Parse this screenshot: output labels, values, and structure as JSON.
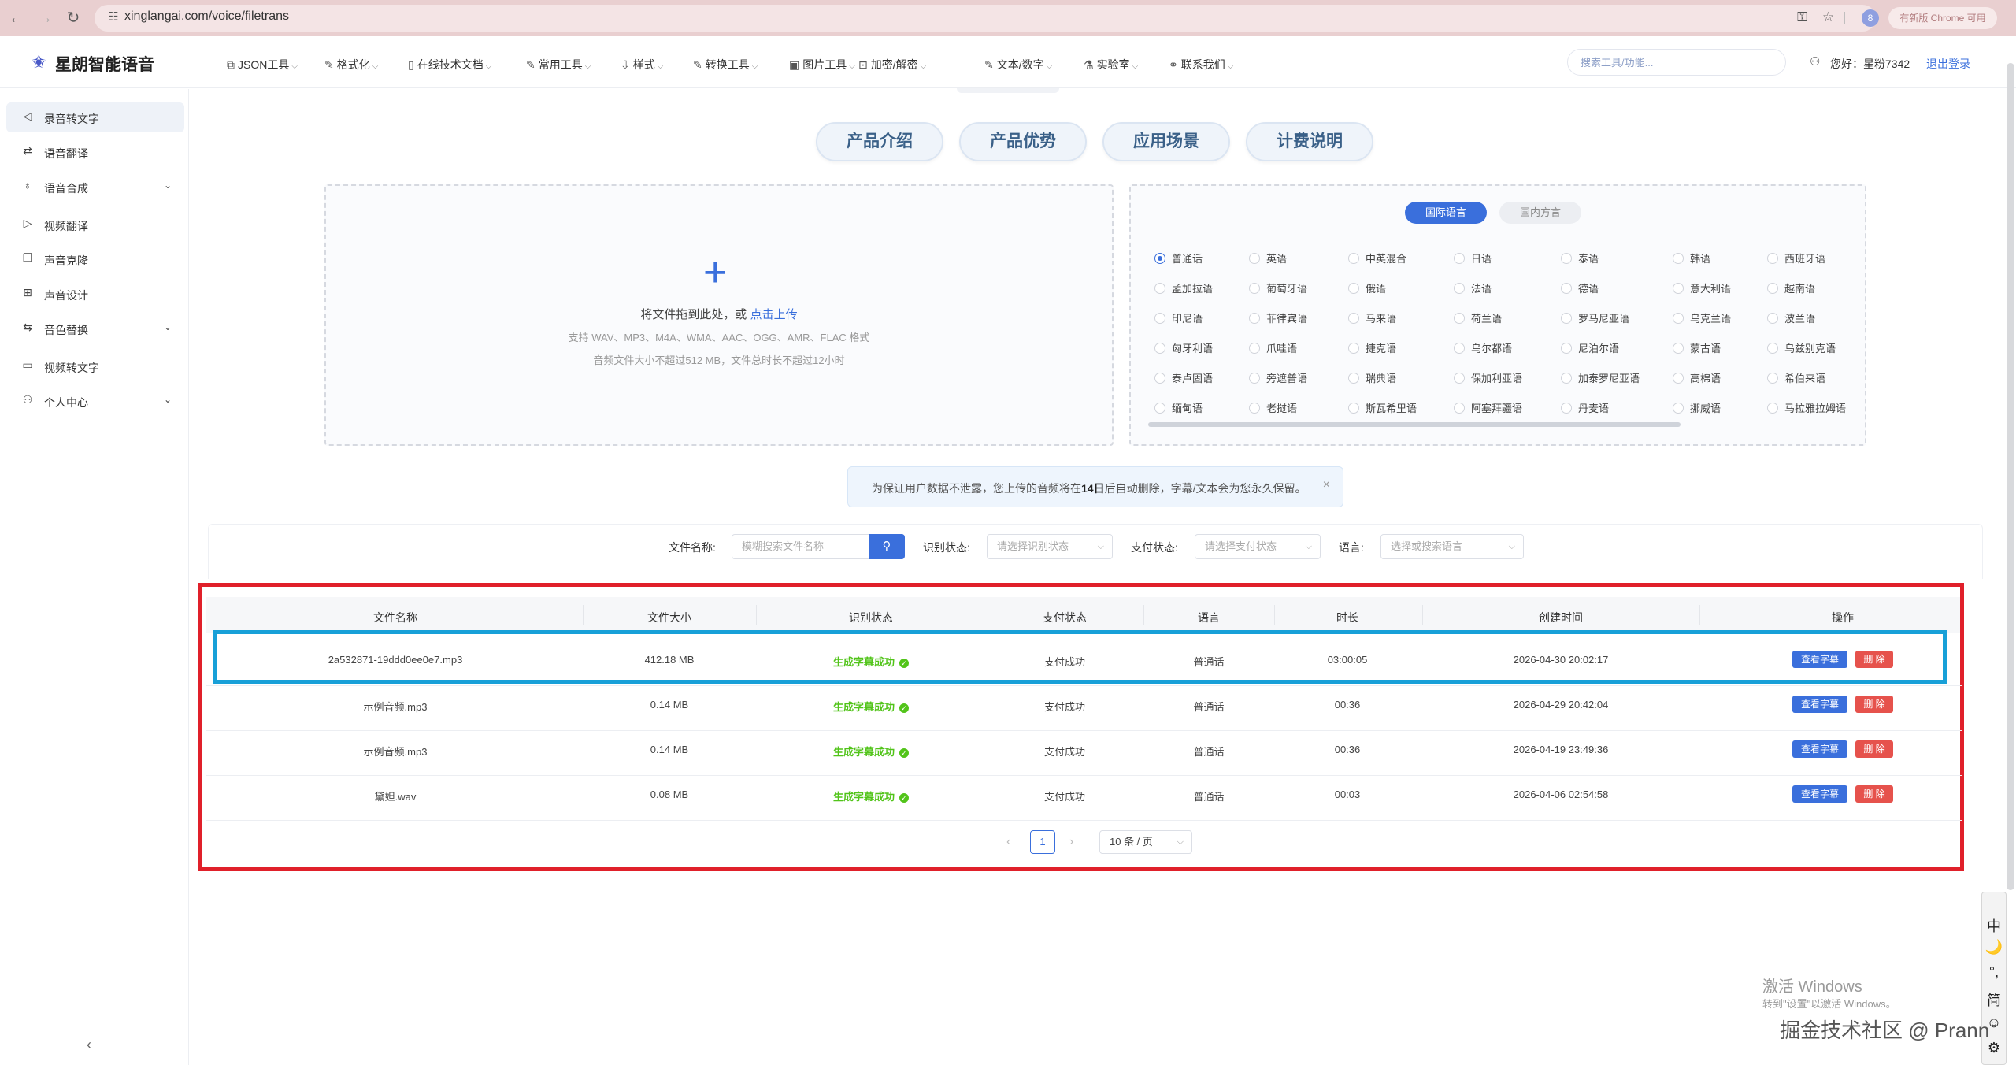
{
  "browser": {
    "url": "xinglangai.com/voice/filetrans",
    "update_label": "有新版 Chrome 可用"
  },
  "header": {
    "logo_text": "星朗智能语音",
    "menu": [
      {
        "icon": "json-icon",
        "label": "JSON工具"
      },
      {
        "icon": "format-icon",
        "label": "格式化"
      },
      {
        "icon": "doc-icon",
        "label": "在线技术文档"
      },
      {
        "icon": "tools-icon",
        "label": "常用工具"
      },
      {
        "icon": "style-icon",
        "label": "样式"
      },
      {
        "icon": "convert-icon",
        "label": "转换工具"
      },
      {
        "icon": "image-icon",
        "label": "图片工具"
      },
      {
        "icon": "lock-icon",
        "label": "加密/解密"
      },
      {
        "icon": "text-icon",
        "label": "文本/数字"
      },
      {
        "icon": "lab-icon",
        "label": "实验室"
      },
      {
        "icon": "link-icon",
        "label": "联系我们"
      }
    ],
    "search_placeholder": "搜索工具/功能...",
    "greeting": "您好：星粉7342",
    "logout": "退出登录"
  },
  "sidebar": {
    "items": [
      {
        "icon": "speaker-icon",
        "label": "录音转文字",
        "active": true
      },
      {
        "icon": "translate-icon",
        "label": "语音翻译"
      },
      {
        "icon": "mic-icon",
        "label": "语音合成",
        "expandable": true
      },
      {
        "icon": "video-icon",
        "label": "视频翻译"
      },
      {
        "icon": "clone-icon",
        "label": "声音克隆"
      },
      {
        "icon": "design-icon",
        "label": "声音设计"
      },
      {
        "icon": "swap-icon",
        "label": "音色替换",
        "expandable": true
      },
      {
        "icon": "video-text-icon",
        "label": "视频转文字"
      },
      {
        "icon": "user-icon",
        "label": "个人中心",
        "expandable": true
      }
    ]
  },
  "product_tabs": [
    "产品介绍",
    "产品优势",
    "应用场景",
    "计费说明"
  ],
  "upload": {
    "main_text": "将文件拖到此处，或 ",
    "link_text": "点击上传",
    "formats": "支持 WAV、MP3、M4A、WMA、AAC、OGG、AMR、FLAC 格式",
    "limits": "音频文件大小不超过512 MB，文件总时长不超过12小时"
  },
  "languages": {
    "tab_intl": "国际语言",
    "tab_domestic": "国内方言",
    "selected": "普通话",
    "rows": [
      [
        "普通话",
        "英语",
        "中英混合",
        "日语",
        "泰语",
        "韩语",
        "西班牙语"
      ],
      [
        "孟加拉语",
        "葡萄牙语",
        "俄语",
        "法语",
        "德语",
        "意大利语",
        "越南语"
      ],
      [
        "印尼语",
        "菲律宾语",
        "马来语",
        "荷兰语",
        "罗马尼亚语",
        "乌克兰语",
        "波兰语"
      ],
      [
        "匈牙利语",
        "爪哇语",
        "捷克语",
        "乌尔都语",
        "尼泊尔语",
        "蒙古语",
        "乌兹别克语"
      ],
      [
        "泰卢固语",
        "旁遮普语",
        "瑞典语",
        "保加利亚语",
        "加泰罗尼亚语",
        "高棉语",
        "希伯来语"
      ],
      [
        "缅甸语",
        "老挝语",
        "斯瓦希里语",
        "阿塞拜疆语",
        "丹麦语",
        "挪威语",
        "马拉雅拉姆语"
      ]
    ]
  },
  "notice": {
    "before": "为保证用户数据不泄露，您上传的音频将在",
    "days": "14日",
    "after": "后自动删除，字幕/文本会为您永久保留。"
  },
  "filters": {
    "file_name_label": "文件名称:",
    "file_name_placeholder": "模糊搜索文件名称",
    "recog_label": "识别状态:",
    "recog_placeholder": "请选择识别状态",
    "pay_label": "支付状态:",
    "pay_placeholder": "请选择支付状态",
    "lang_label": "语言:",
    "lang_placeholder": "选择或搜索语言"
  },
  "table": {
    "headers": [
      "文件名称",
      "文件大小",
      "识别状态",
      "支付状态",
      "语言",
      "时长",
      "创建时间",
      "操作"
    ],
    "rows": [
      {
        "name": "2a532871-19ddd0ee0e7.mp3",
        "size": "412.18 MB",
        "status": "生成字幕成功",
        "pay": "支付成功",
        "lang": "普通话",
        "duration": "03:00:05",
        "created": "2026-04-30 20:02:17"
      },
      {
        "name": "示例音频.mp3",
        "size": "0.14 MB",
        "status": "生成字幕成功",
        "pay": "支付成功",
        "lang": "普通话",
        "duration": "00:36",
        "created": "2026-04-29 20:42:04"
      },
      {
        "name": "示例音频.mp3",
        "size": "0.14 MB",
        "status": "生成字幕成功",
        "pay": "支付成功",
        "lang": "普通话",
        "duration": "00:36",
        "created": "2026-04-19 23:49:36"
      },
      {
        "name": "黛妲.wav",
        "size": "0.08 MB",
        "status": "生成字幕成功",
        "pay": "支付成功",
        "lang": "普通话",
        "duration": "00:03",
        "created": "2026-04-06 02:54:58"
      }
    ],
    "view_label": "查看字幕",
    "delete_label": "删 除"
  },
  "pagination": {
    "current_page": "1",
    "page_size": "10 条 / 页"
  },
  "ime": [
    "中",
    "🌙",
    "°,",
    "简",
    "☺",
    "⚙"
  ],
  "overlay": {
    "activate_title": "激活 Windows",
    "activate_sub": "转到\"设置\"以激活 Windows。",
    "watermark": "掘金技术社区 @ Prann"
  }
}
